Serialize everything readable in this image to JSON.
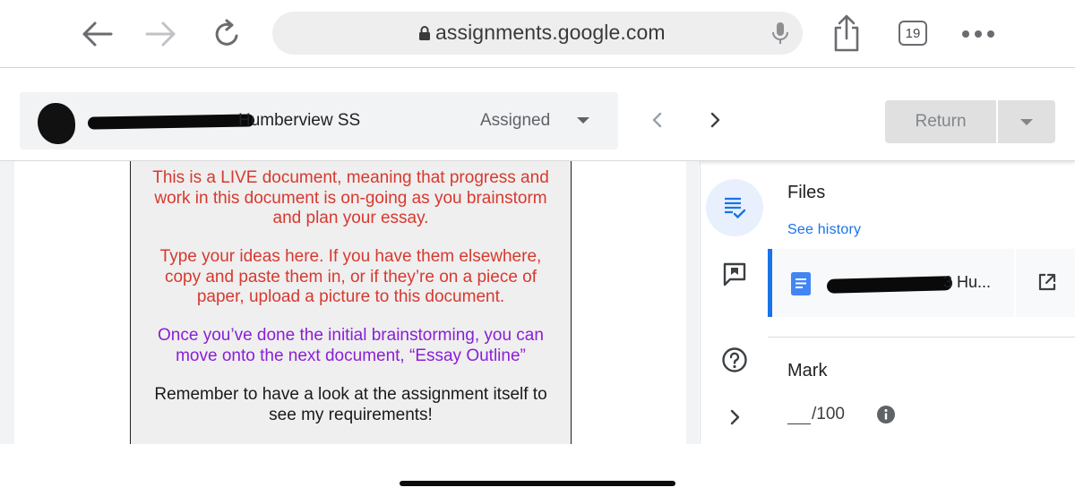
{
  "browser": {
    "url": "assignments.google.com",
    "tab_count": "19"
  },
  "header": {
    "student_school": "Humberview SS",
    "status_label": "Assigned",
    "return_label": "Return"
  },
  "document": {
    "paragraphs": [
      "This is a LIVE document, meaning that progress and work in this document is on-going as you brainstorm and plan your essay.",
      "Type your ideas here. If you have them elsewhere, copy and paste them in, or if they’re on a piece of paper, upload a picture to this document.",
      "Once you’ve done the initial brainstorming, you can move onto the next document, “Essay Outline”",
      "Remember to have a look at the assignment itself to see my requirements!"
    ]
  },
  "panel": {
    "files_title": "Files",
    "see_history": "See history",
    "file_name_visible": "3 Hu...",
    "mark_title": "Mark",
    "mark_value": "/100"
  },
  "colors": {
    "accent": "#1a73e8",
    "doc_red": "#d7392f",
    "doc_purple": "#8a1fd6"
  }
}
